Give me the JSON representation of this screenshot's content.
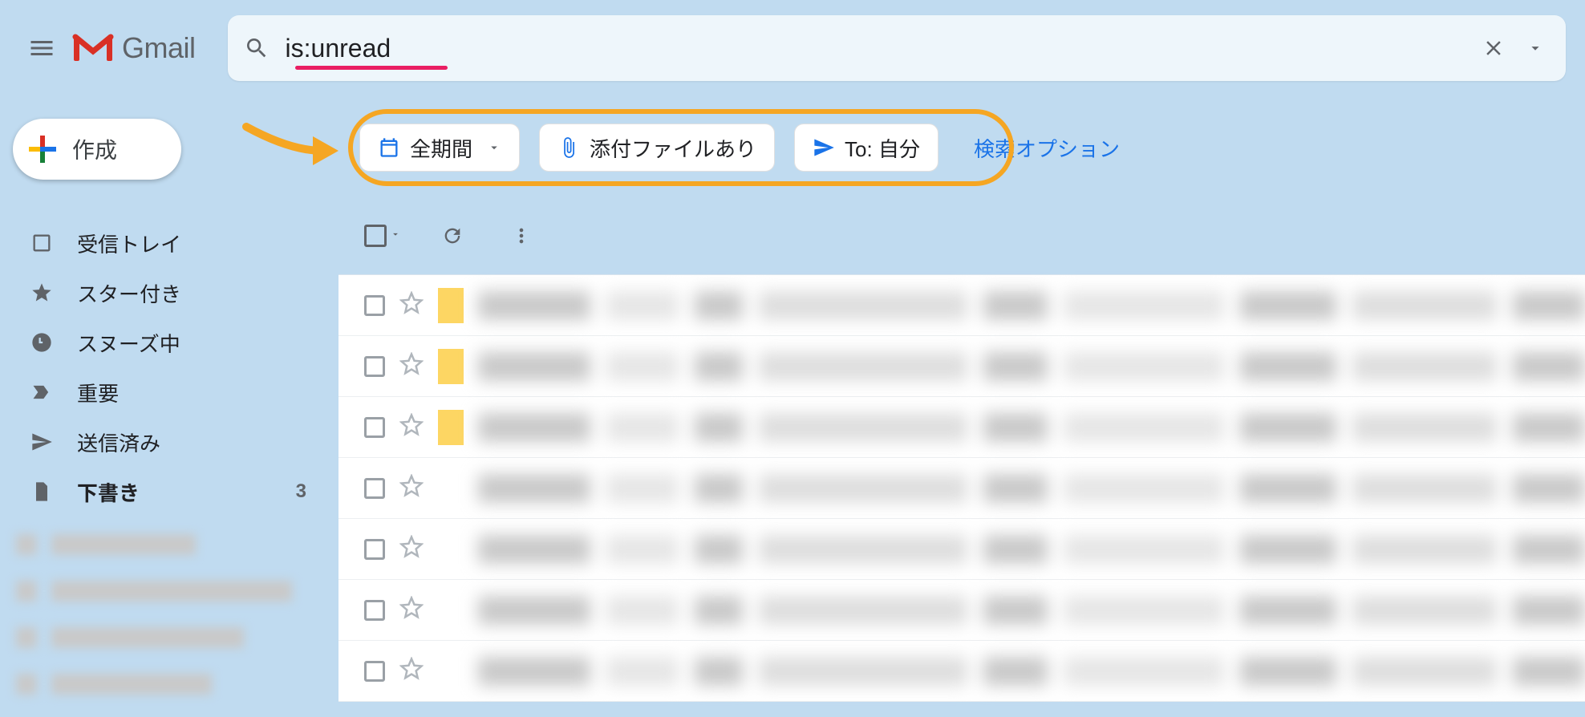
{
  "header": {
    "app_name": "Gmail",
    "search_value": "is:unread"
  },
  "compose_label": "作成",
  "sidebar": {
    "items": [
      {
        "label": "受信トレイ",
        "count": ""
      },
      {
        "label": "スター付き",
        "count": ""
      },
      {
        "label": "スヌーズ中",
        "count": ""
      },
      {
        "label": "重要",
        "count": ""
      },
      {
        "label": "送信済み",
        "count": ""
      },
      {
        "label": "下書き",
        "count": "3",
        "bold": true
      }
    ]
  },
  "filter_chips": {
    "date": "全期間",
    "attachment": "添付ファイルあり",
    "to": "To: 自分"
  },
  "search_options_link": "検索オプション",
  "mail_rows": [
    {
      "important": true
    },
    {
      "important": true
    },
    {
      "important": true
    },
    {
      "important": false
    },
    {
      "important": false
    },
    {
      "important": false
    },
    {
      "important": false
    }
  ]
}
